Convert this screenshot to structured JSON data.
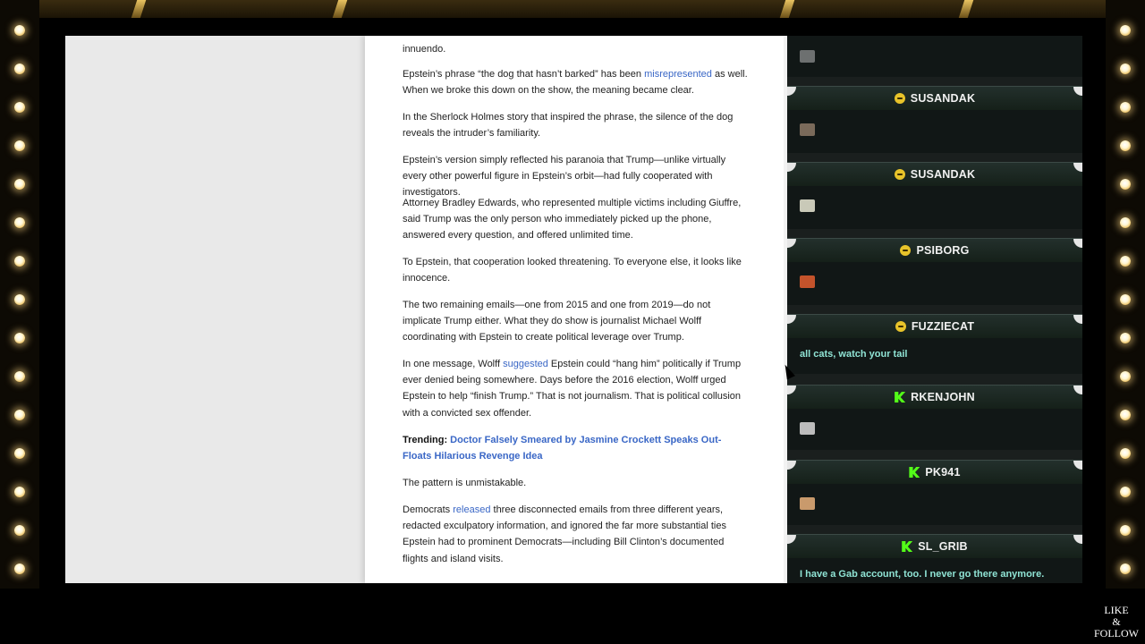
{
  "article": {
    "paragraphs": [
      {
        "parts": [
          {
            "t": "innuendo."
          }
        ]
      },
      {
        "parts": [
          {
            "t": "Epstein’s phrase “the dog that hasn’t barked” has been "
          },
          {
            "t": "misrepresented",
            "link": true
          },
          {
            "t": " as well. When we broke this down on the show, the meaning became clear."
          }
        ]
      },
      {
        "parts": [
          {
            "t": "In the Sherlock Holmes story that inspired the phrase, the silence of the dog reveals the intruder’s familiarity."
          }
        ]
      },
      {
        "parts": [
          {
            "t": "Epstein’s version simply reflected his paranoia that Trump—unlike virtually every other powerful figure in Epstein’s orbit—had fully cooperated with investigators."
          }
        ]
      },
      {
        "parts": [
          {
            "t": "Attorney Bradley Edwards, who represented multiple victims including Giuffre, said Trump was the only person who immediately picked up the phone, answered every question, and offered unlimited time."
          }
        ]
      },
      {
        "parts": [
          {
            "t": "To Epstein, that cooperation looked threatening. To everyone else, it looks like innocence."
          }
        ]
      },
      {
        "parts": [
          {
            "t": "The two remaining emails—one from 2015 and one from 2019—do not implicate Trump either. What they do show is journalist Michael Wolff coordinating with Epstein to create political leverage over Trump."
          }
        ]
      },
      {
        "parts": [
          {
            "t": "In one message, Wolff "
          },
          {
            "t": "suggested",
            "link": true
          },
          {
            "t": " Epstein could “hang him” politically if Trump ever denied being somewhere. Days before the 2016 election, Wolff urged Epstein to help “finish Trump.” That is not journalism. That is political collusion with a convicted sex offender."
          }
        ]
      },
      {
        "parts": [
          {
            "t": "Trending: ",
            "bold": true
          },
          {
            "t": "Doctor Falsely Smeared by Jasmine Crockett Speaks Out-Floats Hilarious Revenge Idea",
            "link": true,
            "bold": true
          }
        ]
      },
      {
        "parts": [
          {
            "t": "The pattern is unmistakable."
          }
        ]
      },
      {
        "parts": [
          {
            "t": "Democrats "
          },
          {
            "t": "released",
            "link": true
          },
          {
            "t": " three disconnected emails from three different years, redacted exculpatory information, and ignored the far more substantial ties Epstein had to prominent Democrats—including Bill Clinton’s documented flights and island visits."
          }
        ]
      }
    ]
  },
  "chat": {
    "messages": [
      {
        "user": "SUSANDAK",
        "badge": "smile",
        "emote": "cat-emote",
        "emote_color": "#7a6a5a",
        "text": ""
      },
      {
        "user": "SUSANDAK",
        "badge": "smile",
        "emote": "bird-emote",
        "emote_color": "#c9c9b8",
        "text": ""
      },
      {
        "user": "PSIBORG",
        "badge": "smile",
        "emote": "flame-emote",
        "emote_color": "#c4532b",
        "text": ""
      },
      {
        "user": "FUZZIECAT",
        "badge": "smile",
        "emote": "",
        "emote_color": "",
        "text": "all cats, watch your tail"
      },
      {
        "user": "RKENJOHN",
        "badge": "kick",
        "emote": "cat-face-emote",
        "emote_color": "#bcbcbc",
        "text": ""
      },
      {
        "user": "PK941",
        "badge": "kick",
        "emote": "face-emote",
        "emote_color": "#c99a6c",
        "text": ""
      },
      {
        "user": "SL_GRIB",
        "badge": "kick",
        "emote": "",
        "emote_color": "",
        "text": "I have a Gab account, too. I never go there anymore."
      }
    ]
  },
  "overlay": {
    "like": "LIKE",
    "amp": "&",
    "follow": "FOLLOW"
  }
}
